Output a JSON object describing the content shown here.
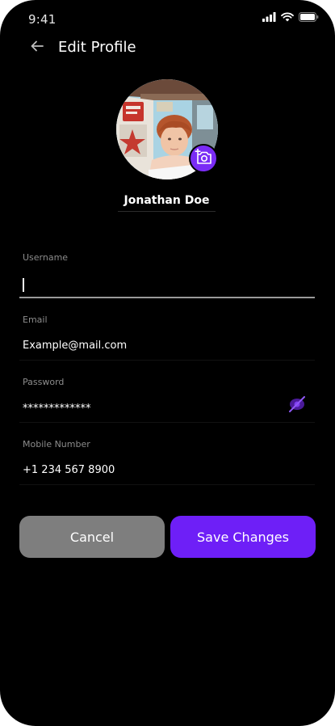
{
  "status_bar": {
    "time": "9:41",
    "icons": [
      "signal-icon",
      "wifi-icon",
      "battery-icon"
    ]
  },
  "header": {
    "back_icon": "arrow-left-icon",
    "title": "Edit Profile"
  },
  "profile": {
    "name": "Jonathan Doe",
    "camera_icon": "add-photo-icon"
  },
  "fields": {
    "username": {
      "label": "Username",
      "value": ""
    },
    "email": {
      "label": "Email",
      "value": "Example@mail.com"
    },
    "password": {
      "label": "Password",
      "value": "*************",
      "toggle_icon": "eye-off-icon"
    },
    "mobile": {
      "label": "Mobile Number",
      "value": "+1 234 567 8900"
    }
  },
  "actions": {
    "cancel_label": "Cancel",
    "save_label": "Save Changes"
  },
  "colors": {
    "background": "#000000",
    "accent": "#6e1ff7",
    "cancel": "#7e7e7e",
    "label": "#8c8c8c"
  }
}
